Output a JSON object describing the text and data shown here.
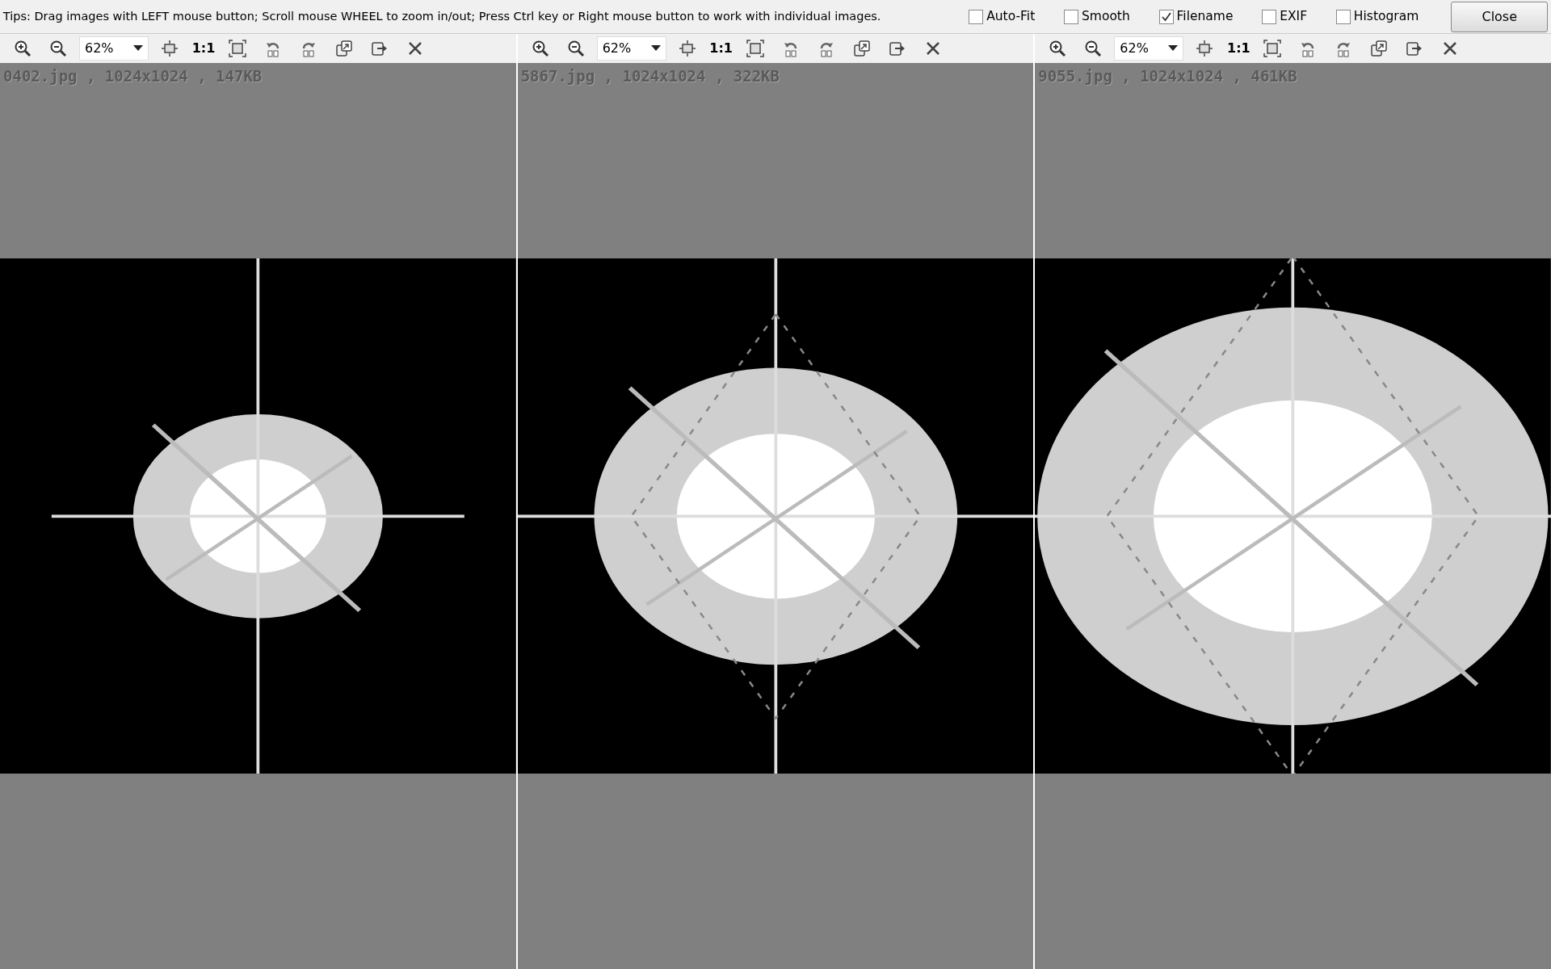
{
  "tips": "Tips: Drag images with LEFT mouse button; Scroll mouse WHEEL to zoom in/out; Press Ctrl key or Right mouse button to work with individual images.",
  "options": [
    {
      "label": "Auto-Fit",
      "checked": false
    },
    {
      "label": "Smooth",
      "checked": false
    },
    {
      "label": "Filename",
      "checked": true
    },
    {
      "label": "EXIF",
      "checked": false
    },
    {
      "label": "Histogram",
      "checked": false
    }
  ],
  "close_button": "Close",
  "panels": [
    {
      "zoom": "62%",
      "actual_size": "1:1",
      "caption": "0402.jpg , 1024x1024 , 147KB"
    },
    {
      "zoom": "62%",
      "actual_size": "1:1",
      "caption": "5867.jpg , 1024x1024 , 322KB"
    },
    {
      "zoom": "62%",
      "actual_size": "1:1",
      "caption": "9055.jpg , 1024x1024 , 461KB"
    }
  ]
}
